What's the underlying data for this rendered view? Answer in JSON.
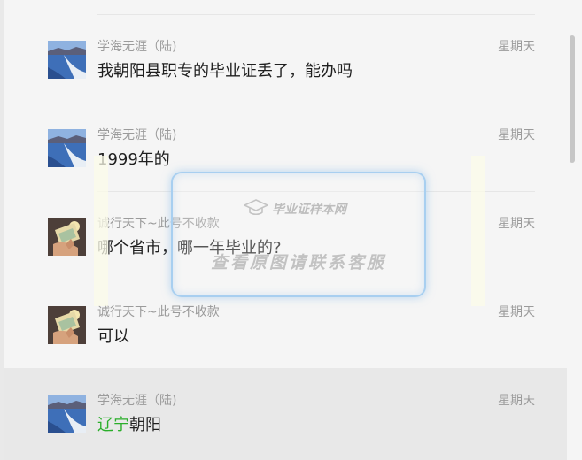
{
  "messages": [
    {
      "name": "学海无涯（陆)",
      "time": "星期天",
      "text": "我朝阳县职专的毕业证丢了，能办吗",
      "avatar": "lake-avatar",
      "selected": false
    },
    {
      "name": "学海无涯（陆)",
      "time": "星期天",
      "text": "1999年的",
      "avatar": "lake-avatar",
      "selected": false
    },
    {
      "name": "诚行天下~此号不收款",
      "time": "星期天",
      "text": "哪个省市，哪一年毕业的?",
      "avatar": "money-hand-avatar",
      "selected": false
    },
    {
      "name": "诚行天下~此号不收款",
      "time": "星期天",
      "text": "可以",
      "avatar": "money-hand-avatar",
      "selected": false
    },
    {
      "name": "学海无涯（陆)",
      "time": "星期天",
      "text_highlight": "辽宁",
      "text_rest": "朝阳",
      "avatar": "lake-avatar",
      "selected": true
    }
  ],
  "watermark": {
    "logo_text": "毕业证样本网",
    "main_text": "查看原图请联系客服"
  },
  "colors": {
    "background": "#f5f5f5",
    "selected_row": "#e8e8e8",
    "name_gray": "#9b9b9b",
    "message_text": "#1f1f1f",
    "highlight_green": "#2aae2a"
  }
}
